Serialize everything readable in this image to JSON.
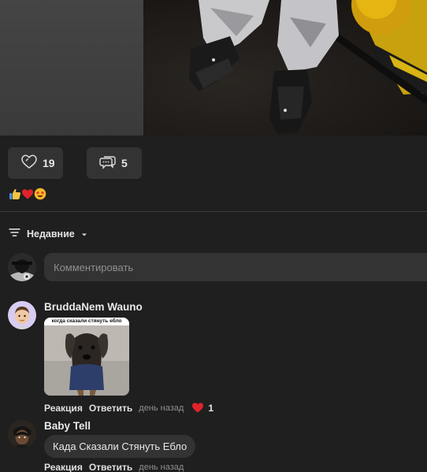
{
  "post": {
    "likes_count": "19",
    "comments_count": "5"
  },
  "reactions": [
    "thumbs-up-icon",
    "heart-icon",
    "star-struck-icon"
  ],
  "sort": {
    "label": "Недавние"
  },
  "composer": {
    "placeholder": "Комментировать"
  },
  "comments": [
    {
      "author": "BruddaNem Wauno",
      "meme_caption": "когда сказали стянуть ебло",
      "reply_label": "Реакция",
      "answer_label": "Ответить",
      "time": "день назад",
      "likes": "1"
    },
    {
      "author": "Baby Tell",
      "text": "Када Сказали Стянуть Ебло",
      "reply_label": "Реакция",
      "answer_label": "Ответить",
      "time": "день назад"
    }
  ],
  "colors": {
    "background": "#1f1f1f",
    "surface": "#333333",
    "heart": "#e0232b"
  }
}
